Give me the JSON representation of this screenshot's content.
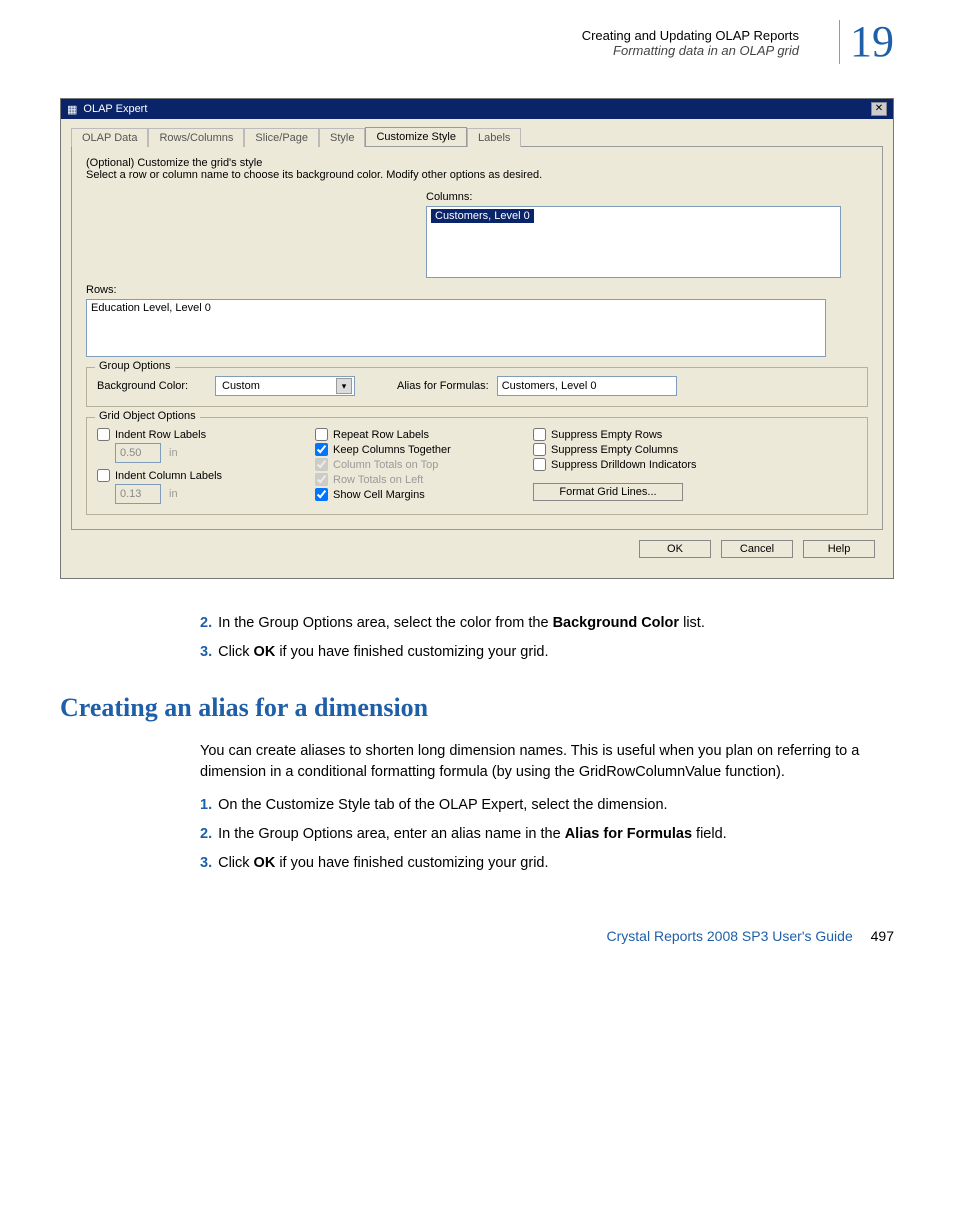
{
  "header": {
    "title": "Creating and Updating OLAP Reports",
    "subtitle": "Formatting data in an OLAP grid",
    "chapter_number": "19"
  },
  "dialog": {
    "window_title": "OLAP Expert",
    "tabs": [
      "OLAP Data",
      "Rows/Columns",
      "Slice/Page",
      "Style",
      "Customize Style",
      "Labels"
    ],
    "active_tab": "Customize Style",
    "intro1": "(Optional) Customize the grid's style",
    "intro2": "Select a row or column name to choose its background color.  Modify other options as desired.",
    "columns_label": "Columns:",
    "columns_item": "Customers, Level 0",
    "rows_label": "Rows:",
    "rows_item": "Education Level, Level 0",
    "group_options": {
      "legend": "Group Options",
      "bg_label": "Background Color:",
      "bg_value": "Custom",
      "alias_label": "Alias for Formulas:",
      "alias_value": "Customers, Level 0"
    },
    "grid_options": {
      "legend": "Grid Object Options",
      "indent_row_labels": "Indent Row Labels",
      "indent_row_value": "0.50",
      "indent_row_unit": "in",
      "indent_col_labels": "Indent Column Labels",
      "indent_col_value": "0.13",
      "indent_col_unit": "in",
      "repeat_row_labels": "Repeat Row Labels",
      "keep_cols_together": "Keep Columns Together",
      "col_totals_on_top": "Column Totals on Top",
      "row_totals_on_left": "Row Totals on Left",
      "show_cell_margins": "Show Cell Margins",
      "suppress_empty_rows": "Suppress Empty Rows",
      "suppress_empty_cols": "Suppress Empty Columns",
      "suppress_drilldown": "Suppress Drilldown Indicators",
      "format_grid_lines": "Format Grid Lines..."
    },
    "buttons": {
      "ok": "OK",
      "cancel": "Cancel",
      "help": "Help"
    }
  },
  "steps_a": {
    "s2": "In the Group Options area, select the color from the Background Color list.",
    "s2_bold": "Background Color",
    "s2_pre": "In the Group Options area, select the color from the ",
    "s2_post": " list.",
    "s3_pre": "Click ",
    "s3_bold": "OK",
    "s3_post": " if you have finished customizing your grid."
  },
  "section_title": "Creating an alias for a dimension",
  "para": "You can create aliases to shorten long dimension names. This is useful when you plan on referring to a dimension in a conditional formatting formula (by using the GridRowColumnValue function).",
  "steps_b": {
    "s1": "On the Customize Style tab of the OLAP Expert, select the dimension.",
    "s2_pre": "In the Group Options area, enter an alias name in the ",
    "s2_bold": "Alias for Formulas",
    "s2_post": " field.",
    "s3_pre": "Click ",
    "s3_bold": "OK",
    "s3_post": " if you have finished customizing your grid."
  },
  "footer": {
    "doc": "Crystal Reports 2008 SP3 User's Guide",
    "page": "497"
  }
}
